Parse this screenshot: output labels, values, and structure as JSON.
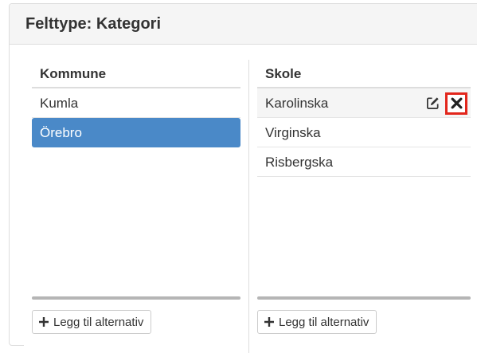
{
  "header": {
    "title": "Felttype: Kategori"
  },
  "columns": [
    {
      "title": "Kommune",
      "items": [
        {
          "label": "Kumla"
        },
        {
          "label": "Örebro"
        }
      ],
      "add_label": "Legg til alternativ"
    },
    {
      "title": "Skole",
      "items": [
        {
          "label": "Karolinska"
        },
        {
          "label": "Virginska"
        },
        {
          "label": "Risbergska"
        }
      ],
      "add_label": "Legg til alternativ"
    }
  ],
  "colors": {
    "selected": "#4a89c8",
    "highlight": "#e2261c"
  },
  "icons": {
    "edit": "edit-icon",
    "delete": "close-icon",
    "add": "plus-icon"
  }
}
